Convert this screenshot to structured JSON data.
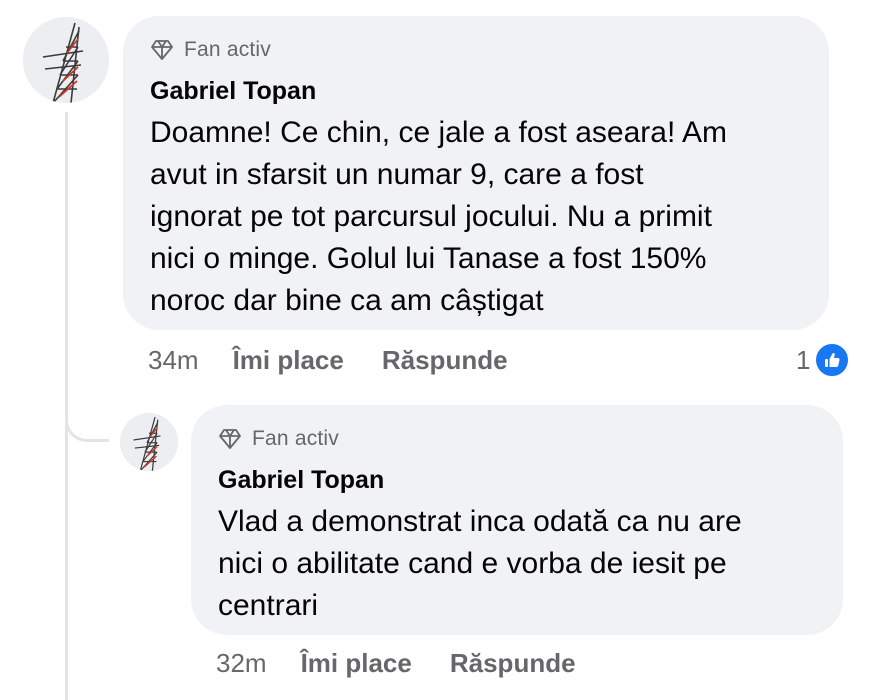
{
  "comment": {
    "badge": "Fan activ",
    "author": "Gabriel Topan",
    "text": "Doamne! Ce chin, ce jale a fost aseara! Am\navut in sfarsit un numar 9, care a fost\nignorat pe tot parcursul jocului. Nu a primit\nnici o minge. Golul lui Tanase a fost 150%\nnoroc dar bine ca am câștigat",
    "time": "34m",
    "like_label": "Îmi place",
    "reply_label": "Răspunde",
    "reaction_count": "1",
    "reaction_icon": "like-icon",
    "reaction_color": "#1877f2"
  },
  "reply": {
    "badge": "Fan activ",
    "author": "Gabriel Topan",
    "text": "Vlad a demonstrat inca odată ca nu are\nnici o abilitate cand e vorba de iesit pe\ncentrari",
    "time": "32m",
    "like_label": "Îmi place",
    "reply_label": "Răspunde"
  },
  "colors": {
    "bubble": "#f0f2f5",
    "secondary_text": "#65676b",
    "primary_text": "#050505",
    "thread_line": "#e2e4e8"
  }
}
